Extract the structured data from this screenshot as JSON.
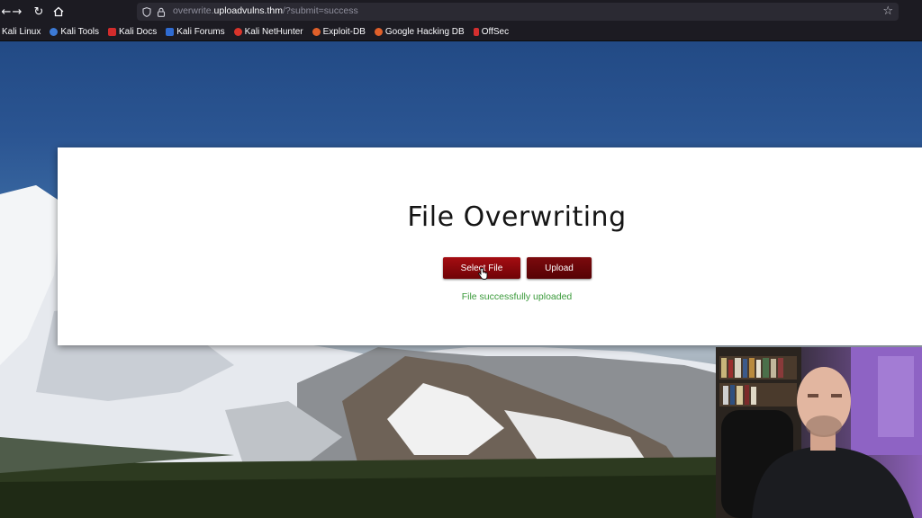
{
  "browser": {
    "url_prefix": "overwrite.",
    "url_host": "uploadvulns.thm",
    "url_path": "/?submit=success",
    "icons": {
      "back": "back-arrow-icon",
      "forward": "forward-arrow-icon",
      "reload": "reload-icon",
      "home": "home-icon",
      "shield": "shield-icon",
      "lock": "lock-icon",
      "star": "star-icon"
    }
  },
  "bookmarks": [
    {
      "label": "Kali Linux",
      "color": "#1b6ac9"
    },
    {
      "label": "Kali Tools",
      "color": "#3c7ad6"
    },
    {
      "label": "Kali Docs",
      "color": "#d22c2c"
    },
    {
      "label": "Kali Forums",
      "color": "#2f6bd1"
    },
    {
      "label": "Kali NetHunter",
      "color": "#d9342b"
    },
    {
      "label": "Exploit-DB",
      "color": "#e0602a"
    },
    {
      "label": "Google Hacking DB",
      "color": "#e0602a"
    },
    {
      "label": "OffSec",
      "color": "#d42f2f"
    }
  ],
  "page": {
    "title": "File Overwriting",
    "select_label": "Select File",
    "upload_label": "Upload",
    "status": "File successfully uploaded",
    "accent": "#8a0a0e",
    "status_color": "#3a9a3a"
  }
}
